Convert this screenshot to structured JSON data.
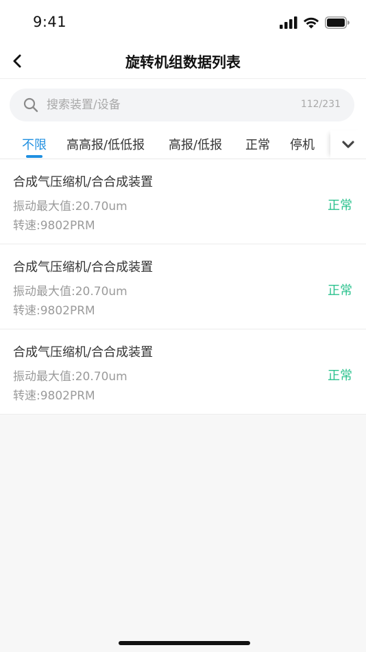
{
  "status_bar": {
    "time": "9:41"
  },
  "nav": {
    "title": "旋转机组数据列表"
  },
  "search": {
    "placeholder": "搜索装置/设备",
    "value": "",
    "count": "112/231"
  },
  "tabs": [
    {
      "label": "不限",
      "active": true
    },
    {
      "label": "高高报/低低报",
      "active": false
    },
    {
      "label": "高报/低报",
      "active": false
    },
    {
      "label": "正常",
      "active": false
    },
    {
      "label": "停机",
      "active": false
    }
  ],
  "items": [
    {
      "title": "合成气压缩机/合合成装置",
      "vibration": "振动最大值:20.70um",
      "speed": "转速:9802PRM",
      "status": "正常"
    },
    {
      "title": "合成气压缩机/合合成装置",
      "vibration": "振动最大值:20.70um",
      "speed": "转速:9802PRM",
      "status": "正常"
    },
    {
      "title": "合成气压缩机/合合成装置",
      "vibration": "振动最大值:20.70um",
      "speed": "转速:9802PRM",
      "status": "正常"
    }
  ],
  "colors": {
    "accent": "#1f8fe0",
    "status_normal": "#2bc28e",
    "secondary_text": "#9b9b9b"
  },
  "icons": [
    "signal-icon",
    "wifi-icon",
    "battery-icon",
    "back-icon",
    "search-icon",
    "chevron-down-icon"
  ]
}
